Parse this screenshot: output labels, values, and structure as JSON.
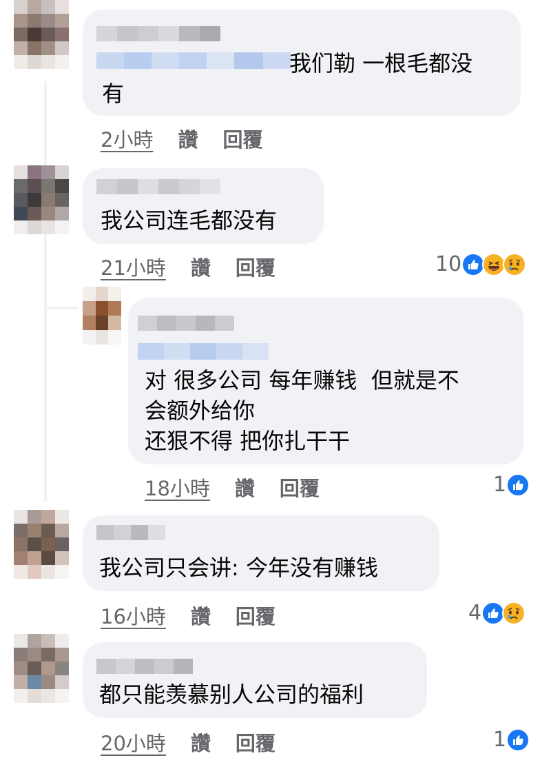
{
  "comments": [
    {
      "text": "我们勒 一根毛都没\n有",
      "time": "2小時",
      "like_label": "讚",
      "reply_label": "回覆",
      "reaction_count": "",
      "reactions": []
    },
    {
      "text": "我公司连毛都没有",
      "time": "21小時",
      "like_label": "讚",
      "reply_label": "回覆",
      "reaction_count": "10",
      "reactions": [
        "like-icon",
        "haha-icon",
        "sad-icon"
      ]
    },
    {
      "text": "对 很多公司 每年赚钱  但就是不\n会额外给你\n还狠不得 把你扎干干",
      "time": "18小時",
      "like_label": "讚",
      "reply_label": "回覆",
      "reaction_count": "1",
      "reactions": [
        "like-icon"
      ]
    },
    {
      "text": "我公司只会讲: 今年没有赚钱",
      "time": "16小時",
      "like_label": "讚",
      "reply_label": "回覆",
      "reaction_count": "4",
      "reactions": [
        "like-icon",
        "sad-icon"
      ]
    },
    {
      "text": "都只能羡慕别人公司的福利",
      "time": "20小時",
      "like_label": "讚",
      "reply_label": "回覆",
      "reaction_count": "1",
      "reactions": [
        "like-icon"
      ]
    }
  ],
  "colors": {
    "bubble": "#f0f2f5",
    "meta_text": "#65676b",
    "like_blue": "#1877f2",
    "emoji_yellow": "#f7b125"
  }
}
